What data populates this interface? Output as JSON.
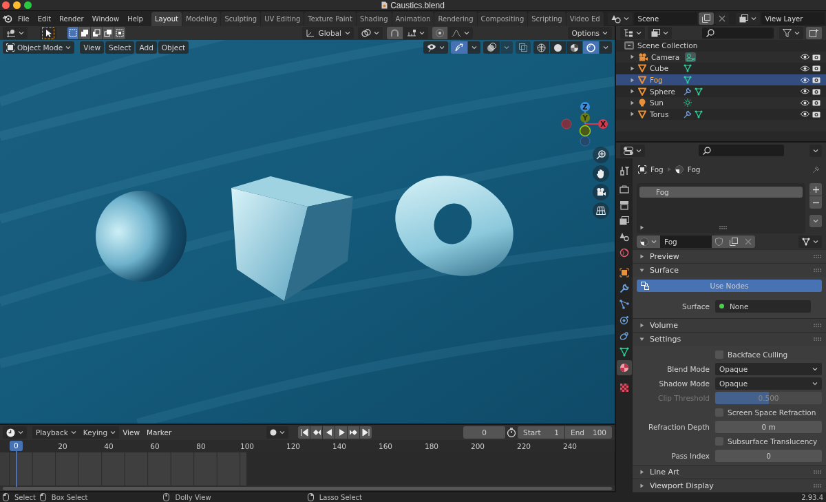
{
  "window": {
    "title": "Caustics.blend"
  },
  "menu": [
    "File",
    "Edit",
    "Render",
    "Window",
    "Help"
  ],
  "workspaces": [
    {
      "label": "Layout",
      "selected": true
    },
    {
      "label": "Modeling",
      "selected": false
    },
    {
      "label": "Sculpting",
      "selected": false
    },
    {
      "label": "UV Editing",
      "selected": false
    },
    {
      "label": "Texture Paint",
      "selected": false
    },
    {
      "label": "Shading",
      "selected": false
    },
    {
      "label": "Animation",
      "selected": false
    },
    {
      "label": "Rendering",
      "selected": false
    },
    {
      "label": "Compositing",
      "selected": false
    },
    {
      "label": "Scripting",
      "selected": false
    },
    {
      "label": "Video Ed",
      "selected": false
    }
  ],
  "scene": {
    "value": "Scene"
  },
  "view_layer": {
    "value": "View Layer"
  },
  "tool_header": {
    "select_modes": [
      {
        "kind": "set",
        "selected": true
      },
      {
        "kind": "extend",
        "selected": false
      },
      {
        "kind": "subtract",
        "selected": false
      },
      {
        "kind": "difference",
        "selected": false
      },
      {
        "kind": "intersect",
        "selected": false
      }
    ],
    "orientation": "Global",
    "options": "Options"
  },
  "viewport": {
    "mode": "Object Mode",
    "menu": [
      "View",
      "Select",
      "Add",
      "Object"
    ],
    "shading_modes": [
      {
        "kind": "wireframe",
        "selected": false
      },
      {
        "kind": "solid",
        "selected": false
      },
      {
        "kind": "material",
        "selected": false
      },
      {
        "kind": "rendered",
        "selected": true
      }
    ],
    "axes": [
      "Z",
      "Y",
      "X"
    ]
  },
  "timeline": {
    "menu": [
      "Playback",
      "Keying",
      "View",
      "Marker"
    ],
    "current_frame": "0",
    "start": {
      "label": "Start",
      "value": "1"
    },
    "end": {
      "label": "End",
      "value": "100"
    },
    "playhead": "0",
    "ticks": [
      "20",
      "40",
      "60",
      "80",
      "100",
      "120",
      "140",
      "160",
      "180",
      "200",
      "220",
      "240"
    ]
  },
  "status_bar": {
    "hints": [
      {
        "kind": "left",
        "label": "Select"
      },
      {
        "kind": "drag",
        "label": "Box Select"
      },
      {
        "kind": "middle",
        "label": "Dolly View"
      },
      {
        "kind": "right-drag",
        "label": "Lasso Select"
      }
    ],
    "version": "2.93.4"
  },
  "outliner": {
    "root": "Scene Collection",
    "items": [
      {
        "name": "Camera",
        "kind": "camera",
        "selected": false,
        "extras": [
          {
            "kind": "camera_data"
          }
        ]
      },
      {
        "name": "Cube",
        "kind": "mesh",
        "selected": false,
        "extras": [
          {
            "kind": "mesh_data"
          }
        ]
      },
      {
        "name": "Fog",
        "kind": "mesh",
        "selected": true,
        "extras": [
          {
            "kind": "mesh_data"
          }
        ]
      },
      {
        "name": "Sphere",
        "kind": "mesh",
        "selected": false,
        "extras": [
          {
            "kind": "modifier"
          },
          {
            "kind": "mesh_data"
          }
        ]
      },
      {
        "name": "Sun",
        "kind": "light",
        "selected": false,
        "extras": [
          {
            "kind": "light_data"
          }
        ]
      },
      {
        "name": "Torus",
        "kind": "mesh",
        "selected": false,
        "extras": [
          {
            "kind": "modifier"
          },
          {
            "kind": "mesh_data"
          }
        ]
      }
    ]
  },
  "properties": {
    "tabs": [
      {
        "kind": "tool",
        "selected": false
      },
      {
        "kind": "render",
        "selected": false
      },
      {
        "kind": "output",
        "selected": false
      },
      {
        "kind": "view_layer",
        "selected": false
      },
      {
        "kind": "scene",
        "selected": false
      },
      {
        "kind": "world",
        "selected": false
      },
      {
        "kind": "object",
        "selected": false
      },
      {
        "kind": "modifier",
        "selected": false
      },
      {
        "kind": "particles",
        "selected": false
      },
      {
        "kind": "physics",
        "selected": false
      },
      {
        "kind": "constraints",
        "selected": false
      },
      {
        "kind": "data",
        "selected": false
      },
      {
        "kind": "material",
        "selected": true
      },
      {
        "kind": "texture",
        "selected": false
      }
    ],
    "breadcrumb": [
      "Fog",
      "Fog"
    ],
    "slots": [
      {
        "label": "Fog",
        "selected": true
      }
    ],
    "material_name": "Fog",
    "panels": [
      {
        "title": "Preview",
        "expanded": false
      },
      {
        "title": "Surface",
        "expanded": true,
        "rows": [
          {
            "kind": "button",
            "label": "Use Nodes",
            "on": true
          },
          {
            "kind": "link",
            "label": "Surface",
            "value": "None"
          }
        ]
      },
      {
        "title": "Volume",
        "expanded": false
      },
      {
        "title": "Settings",
        "expanded": true,
        "rows": [
          {
            "kind": "checkbox",
            "label": "Backface Culling",
            "checked": false
          },
          {
            "kind": "dropdown",
            "label": "Blend Mode",
            "value": "Opaque"
          },
          {
            "kind": "dropdown",
            "label": "Shadow Mode",
            "value": "Opaque"
          },
          {
            "kind": "slider",
            "label": "Clip Threshold",
            "value": "0.500",
            "level": 0.5,
            "disabled": true
          },
          {
            "kind": "checkbox",
            "label": "Screen Space Refraction",
            "checked": false
          },
          {
            "kind": "number",
            "label": "Refraction Depth",
            "value": "0 m"
          },
          {
            "kind": "checkbox",
            "label": "Subsurface Translucency",
            "checked": false
          },
          {
            "kind": "number",
            "label": "Pass Index",
            "value": "0"
          }
        ]
      },
      {
        "title": "Line Art",
        "expanded": false
      },
      {
        "title": "Viewport Display",
        "expanded": false
      }
    ]
  }
}
